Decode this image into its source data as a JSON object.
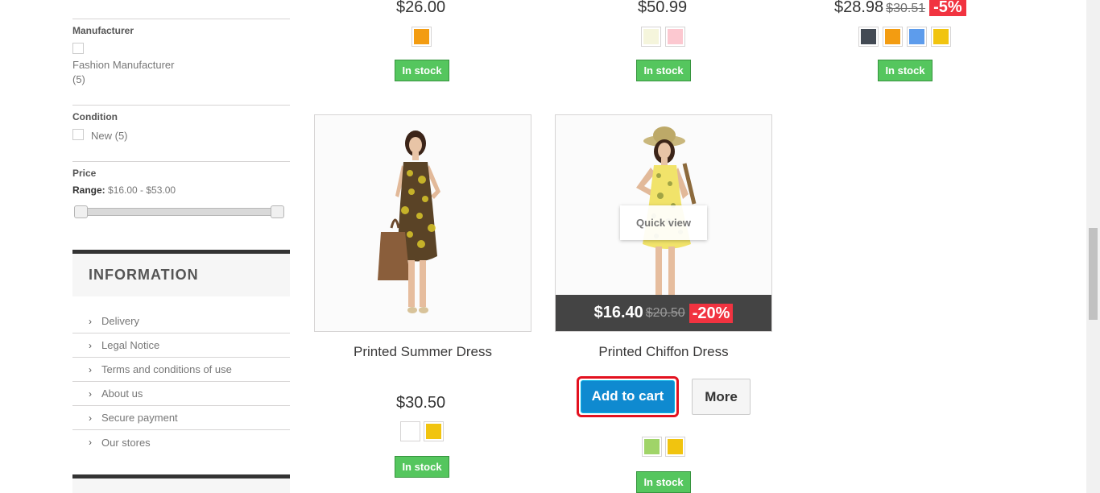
{
  "filters": {
    "manufacturer": {
      "title": "Manufacturer",
      "option": "Fashion Manufacturer",
      "count": "(5)"
    },
    "condition": {
      "title": "Condition",
      "option": "New (5)"
    },
    "price": {
      "title": "Price",
      "range_label": "Range:",
      "range_value": "$16.00 - $53.00",
      "min": "16.00",
      "max": "53.00"
    }
  },
  "information": {
    "title": "INFORMATION",
    "links": [
      "Delivery",
      "Legal Notice",
      "Terms and conditions of use",
      "About us",
      "Secure payment",
      "Our stores"
    ]
  },
  "top_row": [
    {
      "price": "$26.00",
      "swatches": [
        "#f39c11"
      ],
      "stock": "In stock"
    },
    {
      "price": "$50.99",
      "swatches": [
        "#f5f5dc",
        "#fcc8d0"
      ],
      "stock": "In stock"
    },
    {
      "price": "$28.98",
      "old_price": "$30.51",
      "discount": "-5%",
      "swatches": [
        "#434a54",
        "#f39c11",
        "#5d9cec",
        "#f1c40f"
      ],
      "stock": "In stock"
    }
  ],
  "products": [
    {
      "name": "Printed Summer Dress",
      "price": "$30.50",
      "swatches": [
        "#ffffff",
        "#f1c40f"
      ],
      "stock": "In stock"
    },
    {
      "name": "Printed Chiffon Dress",
      "price": "$16.40",
      "old_price": "$20.50",
      "discount": "-20%",
      "quick_view": "Quick view",
      "add_to_cart": "Add to cart",
      "more": "More",
      "swatches": [
        "#a0d468",
        "#f1c40f"
      ],
      "stock": "In stock"
    }
  ],
  "icons": {
    "chevron": "chevron-right-icon",
    "dress": "dress-photo"
  },
  "colors": {
    "stock_green": "#55c65e",
    "cart_blue": "#0f8ad0",
    "discount_red": "#f13340",
    "highlight_red": "#e3111f"
  }
}
